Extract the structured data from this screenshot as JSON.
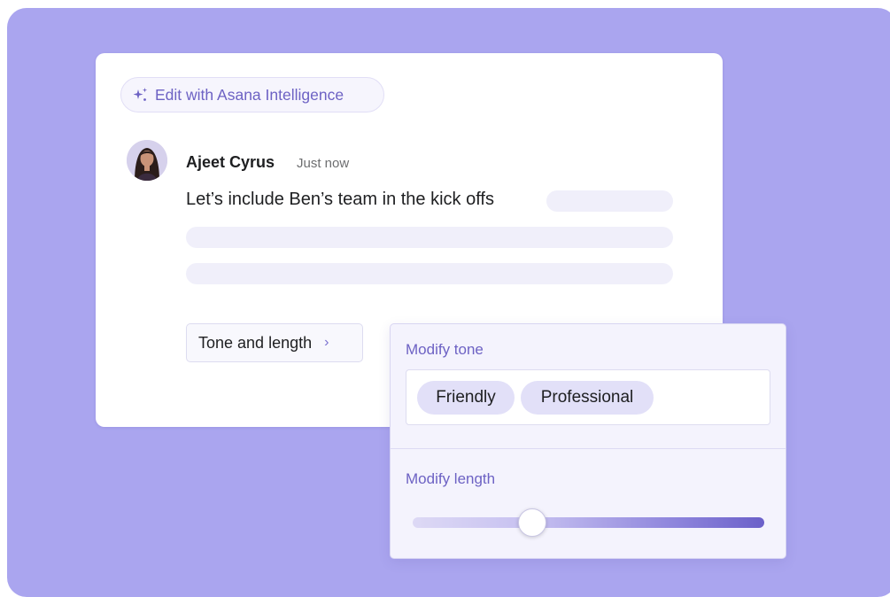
{
  "ai_chip": {
    "label": "Edit with Asana Intelligence",
    "icon": "sparkle-icon"
  },
  "comment": {
    "author": "Ajeet Cyrus",
    "timestamp": "Just now",
    "text": "Let’s include Ben’s team in the kick offs"
  },
  "tone_button": {
    "label": "Tone and length",
    "chevron": "›"
  },
  "panel": {
    "tone_heading": "Modify tone",
    "tone_options": [
      "Friendly",
      "Professional"
    ],
    "length_heading": "Modify length",
    "length_value": 0.34
  },
  "colors": {
    "background": "#aaa5ef",
    "accent": "#6d62c4",
    "pill": "#e2e0f8"
  }
}
